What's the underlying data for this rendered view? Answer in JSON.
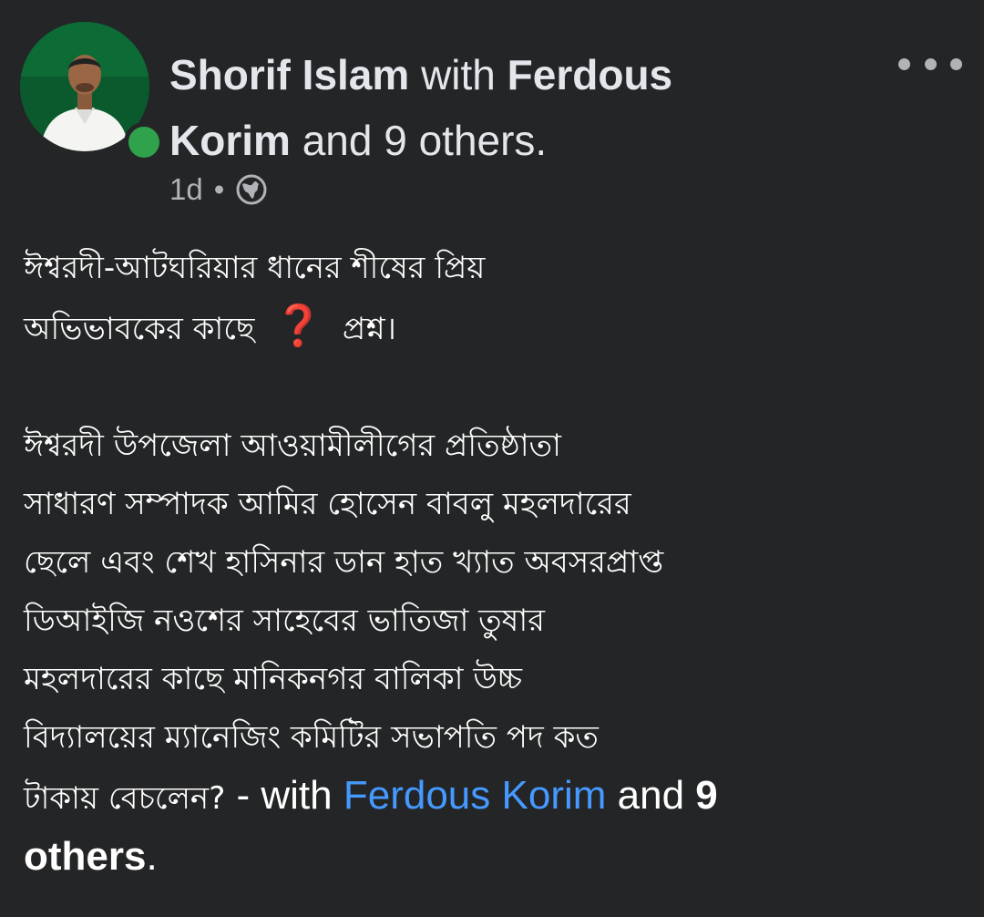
{
  "header": {
    "author": "Shorif Islam",
    "with_word": "with",
    "tagged_first": "Ferdous",
    "tagged_last": "Korim",
    "and_word": "and",
    "others": "9 others.",
    "time": "1d",
    "separator": "•",
    "privacy_icon": "globe-icon",
    "more_icon": "more-options-icon"
  },
  "post": {
    "line1": "ঈশ্বরদী-আটঘরিয়ার ধানের শীষের প্রিয়",
    "line2_before": "অভিভাবকের কাছে",
    "question_emoji": "❓",
    "line2_after": "প্রশ্ন।",
    "para2": [
      "ঈশ্বরদী উপজেলা আওয়ামীলীগের প্রতিষ্ঠাতা",
      "সাধারণ সম্পাদক আমির হোসেন বাবলু মহলদারের",
      "ছেলে এবং শেখ হাসিনার ডান হাত খ্যাত অবসরপ্রাপ্ত",
      "ডিআইজি নওশের সাহেবের ভাতিজা তুষার",
      "মহলদারের কাছে মানিকনগর বালিকা উচ্চ",
      "বিদ্যালয়ের ম্যানেজিং কমিটির সভাপতি পদ কত"
    ],
    "last_line_bn": "টাকায় বেচলেন?",
    "tail_prefix": " - with ",
    "tag_link": "Ferdous Korim",
    "tail_and": " and ",
    "tail_count": "9",
    "tail_others": "others",
    "tail_end": "."
  },
  "colors": {
    "background": "#242526",
    "text": "#e4e6eb",
    "muted": "#b0b3b8",
    "link": "#4599ff",
    "online": "#31a24c",
    "question": "#e0245e"
  }
}
